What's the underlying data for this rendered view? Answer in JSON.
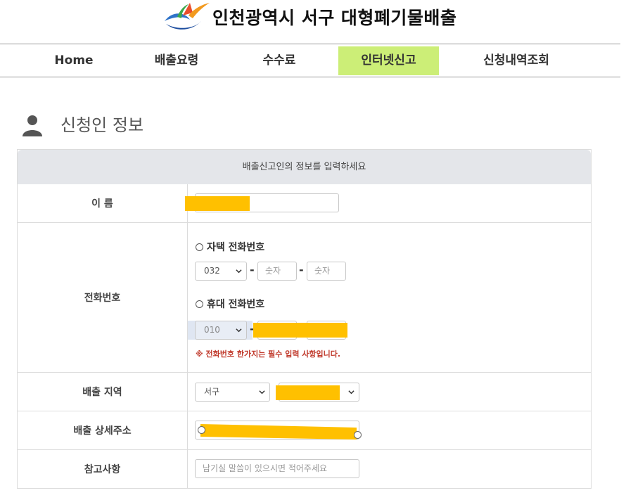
{
  "header": {
    "site_title": "인천광역시 서구  대형폐기물배출"
  },
  "nav": {
    "items": [
      {
        "label": "Home"
      },
      {
        "label": "배출요령"
      },
      {
        "label": "수수료"
      },
      {
        "label": "인터넷신고"
      },
      {
        "label": "신청내역조회"
      }
    ],
    "active_index": 3,
    "active_color": "#ccee77"
  },
  "section": {
    "title": "신청인 정보"
  },
  "form": {
    "header": "배출신고인의 정보를 입력하세요",
    "name": {
      "label": "이 름"
    },
    "phone": {
      "label": "전화번호",
      "home": {
        "radio_label": "자택 전화번호",
        "area_code": "032",
        "part2_placeholder": "숫자",
        "part3_placeholder": "숫자"
      },
      "mobile": {
        "radio_label": "휴대 전화번호",
        "prefix": "010"
      },
      "notice": "※ 전화번호 한가지는 필수 입력 사항입니다."
    },
    "region": {
      "label": "배출 지역",
      "district": "서구"
    },
    "address": {
      "label": "배출 상세주소"
    },
    "notes": {
      "label": "참고사항",
      "placeholder": "남기실 말씀이 있으시면 적어주세요"
    }
  },
  "colors": {
    "redaction": "#ffc000",
    "notice": "#c0392b",
    "form_header_bg": "#e4e6ea"
  }
}
